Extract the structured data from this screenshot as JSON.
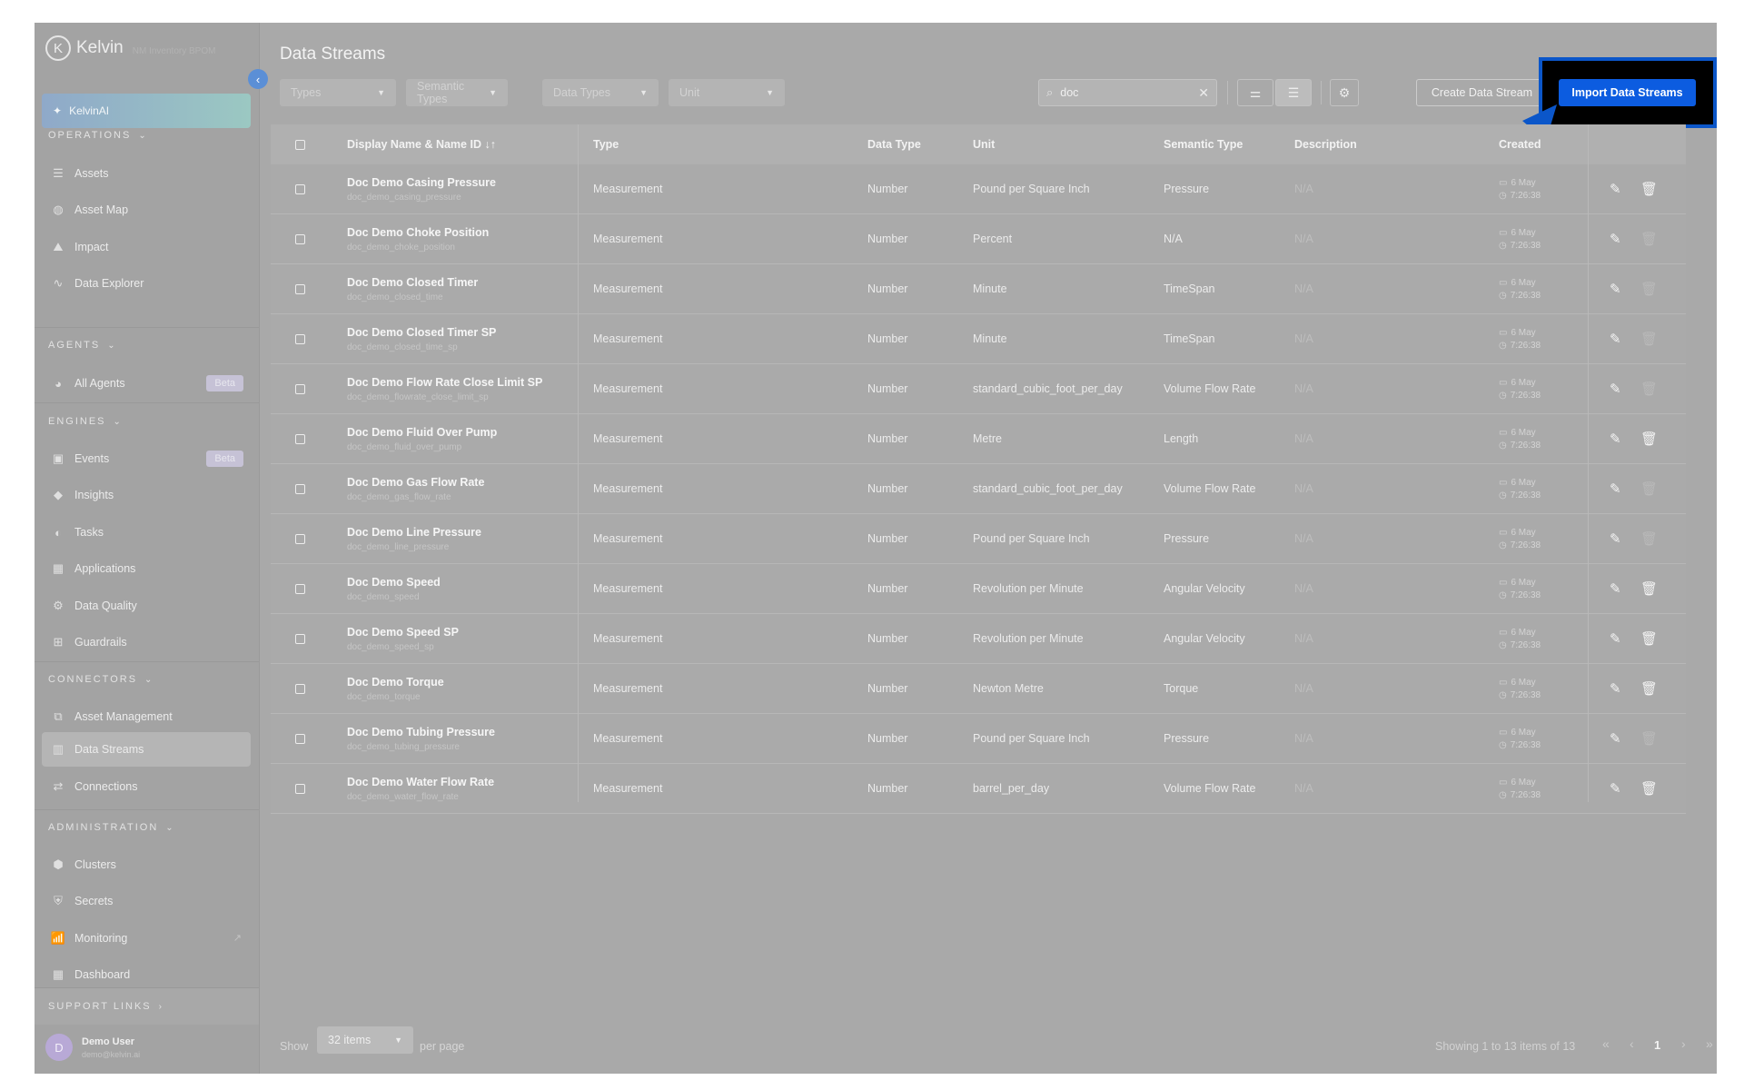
{
  "app": {
    "brand": "Kelvin",
    "brand_sub": "NM Inventory BPOM"
  },
  "sidebar": {
    "kelvinai": "KelvinAI",
    "sections": {
      "operations": "OPERATIONS",
      "agents": "AGENTS",
      "engines": "ENGINES",
      "connectors": "CONNECTORS",
      "administration": "ADMINISTRATION",
      "support": "SUPPORT LINKS"
    },
    "items": {
      "assets": "Assets",
      "asset_map": "Asset Map",
      "impact": "Impact",
      "data_explorer": "Data Explorer",
      "all_agents": "All Agents",
      "events": "Events",
      "insights": "Insights",
      "tasks": "Tasks",
      "applications": "Applications",
      "data_quality": "Data Quality",
      "guardrails": "Guardrails",
      "asset_management": "Asset Management",
      "data_streams": "Data Streams",
      "connections": "Connections",
      "clusters": "Clusters",
      "secrets": "Secrets",
      "monitoring": "Monitoring",
      "dashboard": "Dashboard"
    },
    "beta": "Beta",
    "user": {
      "initial": "D",
      "name": "Demo User",
      "email": "demo@kelvin.ai"
    }
  },
  "page": {
    "title": "Data Streams"
  },
  "filters": {
    "types": "Types",
    "semantic_types": "Semantic Types",
    "data_types": "Data Types",
    "unit": "Unit"
  },
  "search": {
    "value": "doc"
  },
  "buttons": {
    "create": "Create Data Stream",
    "import": "Import Data Streams"
  },
  "table": {
    "headers": {
      "name": "Display Name & Name ID ↓↑",
      "type": "Type",
      "data_type": "Data Type",
      "unit": "Unit",
      "semantic_type": "Semantic Type",
      "description": "Description",
      "created": "Created"
    },
    "rows": [
      {
        "name": "Doc Demo Casing Pressure",
        "id": "doc_demo_casing_pressure",
        "type": "Measurement",
        "data_type": "Number",
        "unit": "Pound per Square Inch",
        "semantic": "Pressure",
        "description": "N/A",
        "date": "6 May",
        "time": "7:26:38",
        "deletable": true
      },
      {
        "name": "Doc Demo Choke Position",
        "id": "doc_demo_choke_position",
        "type": "Measurement",
        "data_type": "Number",
        "unit": "Percent",
        "semantic": "N/A",
        "description": "N/A",
        "date": "6 May",
        "time": "7:26:38",
        "deletable": false
      },
      {
        "name": "Doc Demo Closed Timer",
        "id": "doc_demo_closed_time",
        "type": "Measurement",
        "data_type": "Number",
        "unit": "Minute",
        "semantic": "TimeSpan",
        "description": "N/A",
        "date": "6 May",
        "time": "7:26:38",
        "deletable": false
      },
      {
        "name": "Doc Demo Closed Timer SP",
        "id": "doc_demo_closed_time_sp",
        "type": "Measurement",
        "data_type": "Number",
        "unit": "Minute",
        "semantic": "TimeSpan",
        "description": "N/A",
        "date": "6 May",
        "time": "7:26:38",
        "deletable": false
      },
      {
        "name": "Doc Demo Flow Rate Close Limit SP",
        "id": "doc_demo_flowrate_close_limit_sp",
        "type": "Measurement",
        "data_type": "Number",
        "unit": "standard_cubic_foot_per_day",
        "semantic": "Volume Flow Rate",
        "description": "N/A",
        "date": "6 May",
        "time": "7:26:38",
        "deletable": false
      },
      {
        "name": "Doc Demo Fluid Over Pump",
        "id": "doc_demo_fluid_over_pump",
        "type": "Measurement",
        "data_type": "Number",
        "unit": "Metre",
        "semantic": "Length",
        "description": "N/A",
        "date": "6 May",
        "time": "7:26:38",
        "deletable": true
      },
      {
        "name": "Doc Demo Gas Flow Rate",
        "id": "doc_demo_gas_flow_rate",
        "type": "Measurement",
        "data_type": "Number",
        "unit": "standard_cubic_foot_per_day",
        "semantic": "Volume Flow Rate",
        "description": "N/A",
        "date": "6 May",
        "time": "7:26:38",
        "deletable": false
      },
      {
        "name": "Doc Demo Line Pressure",
        "id": "doc_demo_line_pressure",
        "type": "Measurement",
        "data_type": "Number",
        "unit": "Pound per Square Inch",
        "semantic": "Pressure",
        "description": "N/A",
        "date": "6 May",
        "time": "7:26:38",
        "deletable": false
      },
      {
        "name": "Doc Demo Speed",
        "id": "doc_demo_speed",
        "type": "Measurement",
        "data_type": "Number",
        "unit": "Revolution per Minute",
        "semantic": "Angular Velocity",
        "description": "N/A",
        "date": "6 May",
        "time": "7:26:38",
        "deletable": true
      },
      {
        "name": "Doc Demo Speed SP",
        "id": "doc_demo_speed_sp",
        "type": "Measurement",
        "data_type": "Number",
        "unit": "Revolution per Minute",
        "semantic": "Angular Velocity",
        "description": "N/A",
        "date": "6 May",
        "time": "7:26:38",
        "deletable": true
      },
      {
        "name": "Doc Demo Torque",
        "id": "doc_demo_torque",
        "type": "Measurement",
        "data_type": "Number",
        "unit": "Newton Metre",
        "semantic": "Torque",
        "description": "N/A",
        "date": "6 May",
        "time": "7:26:38",
        "deletable": true
      },
      {
        "name": "Doc Demo Tubing Pressure",
        "id": "doc_demo_tubing_pressure",
        "type": "Measurement",
        "data_type": "Number",
        "unit": "Pound per Square Inch",
        "semantic": "Pressure",
        "description": "N/A",
        "date": "6 May",
        "time": "7:26:38",
        "deletable": false
      },
      {
        "name": "Doc Demo Water Flow Rate",
        "id": "doc_demo_water_flow_rate",
        "type": "Measurement",
        "data_type": "Number",
        "unit": "barrel_per_day",
        "semantic": "Volume Flow Rate",
        "description": "N/A",
        "date": "6 May",
        "time": "7:26:38",
        "deletable": true
      }
    ]
  },
  "footer": {
    "show": "Show",
    "per_page_value": "32 items",
    "per_page": "per page",
    "count": "Showing 1 to 13 items of 13",
    "current_page": "1"
  },
  "colors": {
    "import_button": "#0c5ce0",
    "annotation_arrow": "#0b56c9"
  }
}
